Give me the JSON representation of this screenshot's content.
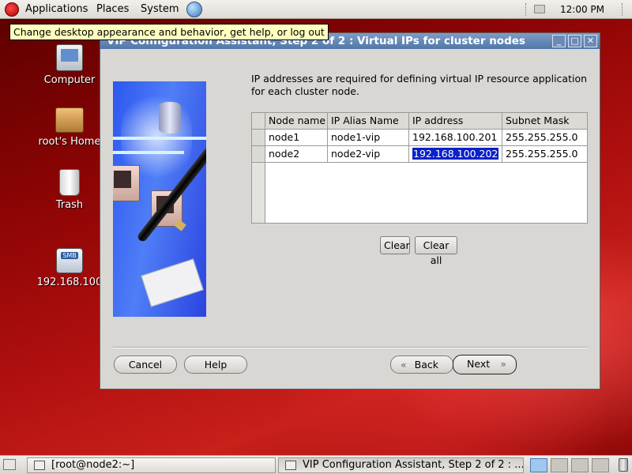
{
  "topbar": {
    "menus": [
      "Applications",
      "Places",
      "System"
    ],
    "clock": "12:00 PM"
  },
  "tooltip": "Change desktop appearance and behavior, get help, or log out",
  "desktop_icons": [
    {
      "label": "Computer",
      "icon": "computer-icon"
    },
    {
      "label": "root's Home",
      "icon": "home-folder-icon"
    },
    {
      "label": "Trash",
      "icon": "trash-icon"
    },
    {
      "label": "192.168.100",
      "icon": "smb-share-icon",
      "badge": "SMB"
    }
  ],
  "dialog": {
    "title": "VIP Configuration Assistant, Step 2 of 2 : Virtual IPs for cluster nodes",
    "description": "IP addresses are required for defining virtual IP resource application for each cluster node.",
    "table": {
      "columns": [
        "Node name",
        "IP Alias Name",
        "IP address",
        "Subnet Mask"
      ],
      "rows": [
        [
          "node1",
          "node1-vip",
          "192.168.100.201",
          "255.255.255.0"
        ],
        [
          "node2",
          "node2-vip",
          "192.168.100.202",
          "255.255.255.0"
        ]
      ],
      "selected_cell": "192.168.100.202"
    },
    "buttons": {
      "clear": "Clear",
      "clear_all": "Clear all",
      "cancel": "Cancel",
      "help": "Help",
      "back": "Back",
      "next": "Next"
    }
  },
  "taskbar": {
    "tasks": [
      {
        "label": "[root@node2:~]"
      },
      {
        "label": "VIP Configuration Assistant, Step 2 of 2 : ..."
      }
    ],
    "active_workspace": 1,
    "workspace_count": 4
  },
  "colors": {
    "title_bar": "#5f84b6",
    "selection": "#0b21c8",
    "desktop": "#a8100f",
    "tooltip_bg": "#ffffbf"
  }
}
